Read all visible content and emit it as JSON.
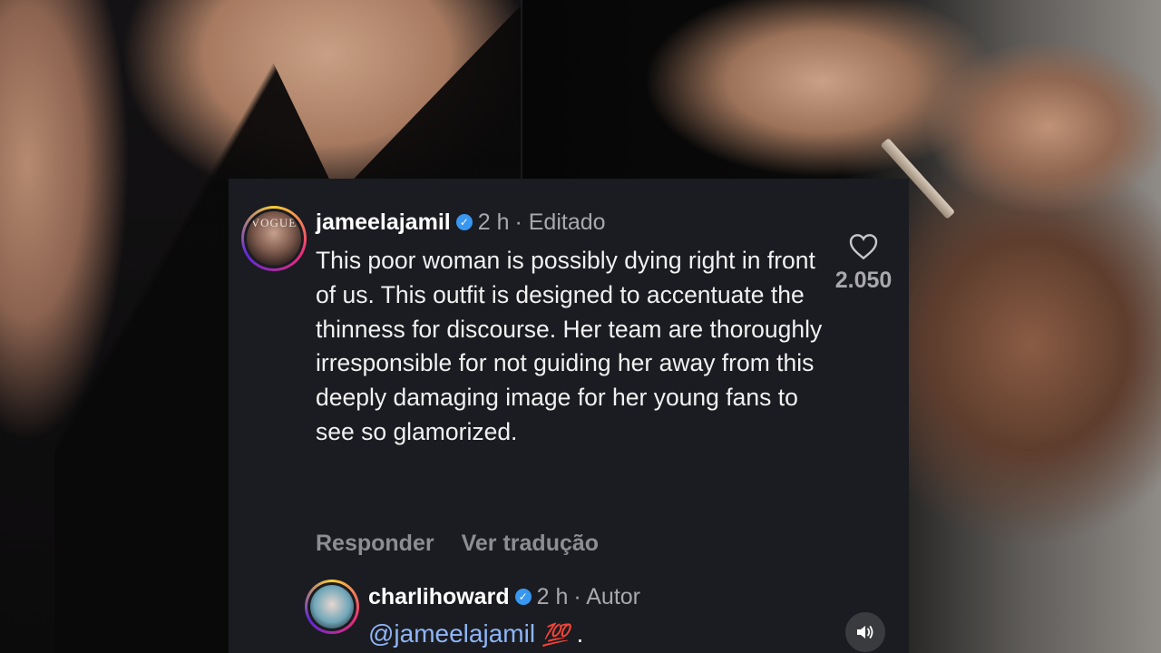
{
  "comment": {
    "username": "jameelajamil",
    "verified_icon": "verified-badge-icon",
    "time": "2 h",
    "edited": "· Editado",
    "avatar_text": "VOGUE",
    "text": "This poor woman is possibly dying right in front of us. This outfit is designed to accentuate the thinness for discourse. Her team are thoroughly irresponsible for not guiding her away from this deeply damaging image for her young fans to see so glamorized.",
    "likes": "2.050",
    "like_icon": "heart-icon",
    "reply_label": "Responder",
    "translate_label": "Ver tradução"
  },
  "reply": {
    "username": "charlihoward",
    "verified_icon": "verified-badge-icon",
    "time": "2 h",
    "role": "· Autor",
    "mention": "@jameelajamil",
    "emoji": "💯",
    "trailing": " ."
  },
  "media": {
    "sound_icon": "speaker-icon"
  },
  "colors": {
    "card_bg": "#1a1c21",
    "verified": "#3897f0",
    "mention": "#8fb5f7",
    "muted": "#a8a8ad"
  }
}
